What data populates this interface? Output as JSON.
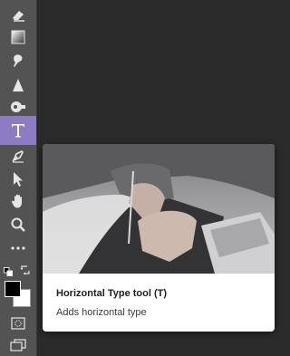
{
  "toolbar": {
    "tools": [
      {
        "name": "eraser-tool",
        "icon": "eraser-icon"
      },
      {
        "name": "gradient-tool",
        "icon": "gradient-icon"
      },
      {
        "name": "smudge-tool",
        "icon": "smudge-icon"
      },
      {
        "name": "sharpen-tool",
        "icon": "triangle-icon"
      },
      {
        "name": "dodge-tool",
        "icon": "dodge-icon"
      },
      {
        "name": "type-tool",
        "icon": "type-icon",
        "active": true
      },
      {
        "name": "pen-tool",
        "icon": "pen-icon"
      },
      {
        "name": "path-selection-tool",
        "icon": "arrow-icon"
      },
      {
        "name": "hand-tool",
        "icon": "hand-icon"
      },
      {
        "name": "zoom-tool",
        "icon": "magnifier-icon"
      },
      {
        "name": "more-tools",
        "icon": "ellipsis-icon"
      }
    ],
    "colors": {
      "active_highlight": "#8e7cc3",
      "foreground": "#000000",
      "background": "#ffffff"
    }
  },
  "tooltip": {
    "title": "Horizontal Type tool (T)",
    "description": "Adds horizontal type"
  }
}
